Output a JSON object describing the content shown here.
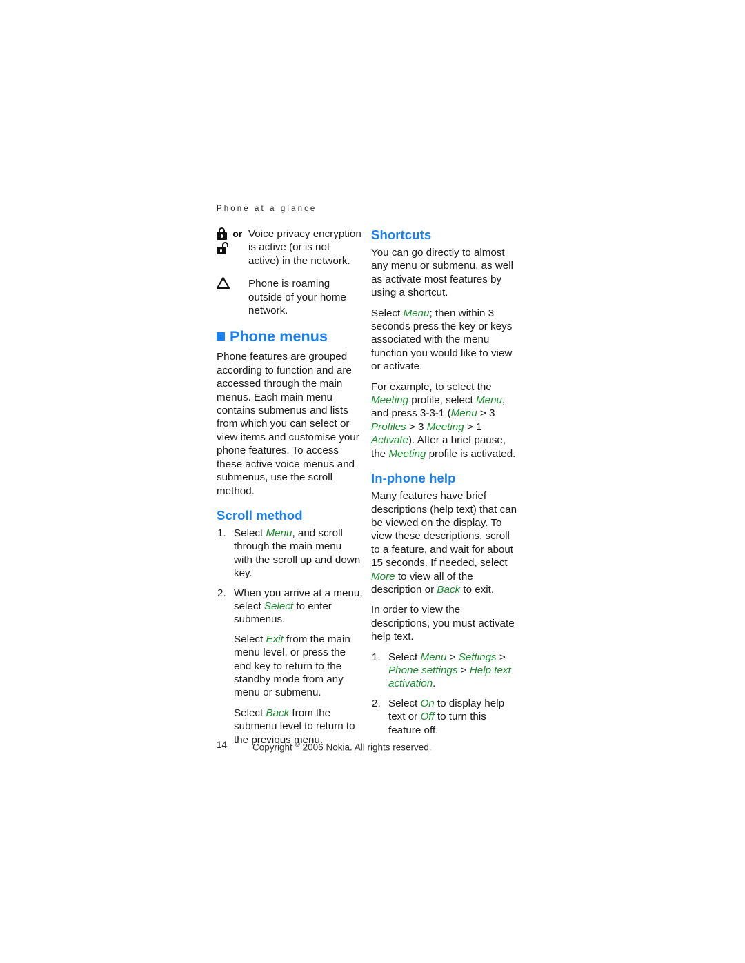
{
  "header": {
    "running_title": "Phone at a glance"
  },
  "icons": {
    "lock_closed": "padlock-closed-icon",
    "lock_open": "padlock-open-icon",
    "roaming": "roaming-triangle-icon",
    "or_label": "or"
  },
  "status_indicators": [
    {
      "text": "Voice privacy encryption is active (or is not active) in the network."
    },
    {
      "text": "Phone is roaming outside of your home network."
    }
  ],
  "left_column": {
    "chapter_heading": "Phone menus",
    "intro": "Phone features are grouped according to function and are accessed through the main menus. Each main menu contains submenus and lists from which you can select or view items and customise your phone features. To access these active voice menus and submenus, use the scroll method.",
    "scroll_method": {
      "heading": "Scroll method",
      "step1_pre": "Select ",
      "step1_term": "Menu",
      "step1_post": ", and scroll through the main menu with the scroll up and down key.",
      "step2_pre": "When you arrive at a menu, select ",
      "step2_term": "Select",
      "step2_post": " to enter submenus.",
      "note1_pre": "Select ",
      "note1_term": "Exit",
      "note1_post": " from the main menu level, or press the end key to return to the standby mode from any menu or submenu.",
      "note2_pre": "Select ",
      "note2_term": "Back",
      "note2_post": " from the submenu level to return to the previous menu."
    }
  },
  "right_column": {
    "shortcuts": {
      "heading": "Shortcuts",
      "p1": "You can go directly to almost any menu or submenu, as well as activate most features by using a shortcut.",
      "p2_pre": "Select ",
      "p2_term": "Menu",
      "p2_post": "; then within 3 seconds press the key or keys associated with the menu function you would like to view or activate.",
      "p3_a": "For example, to select the ",
      "p3_term1": "Meeting",
      "p3_b": " profile, select ",
      "p3_term2": "Menu",
      "p3_c": ", and press 3-3-1 (",
      "p3_term3": "Menu",
      "p3_d": " > 3 ",
      "p3_term4": "Profiles",
      "p3_e": " > 3 ",
      "p3_term5": "Meeting",
      "p3_f": " > 1 ",
      "p3_term6": "Activate",
      "p3_g": "). After a brief pause, the ",
      "p3_term7": "Meeting",
      "p3_h": " profile is activated."
    },
    "in_phone_help": {
      "heading": "In-phone help",
      "p1_a": "Many features have brief descriptions (help text) that can be viewed on the display. To view these descriptions, scroll to a feature, and wait for about 15 seconds. If needed, select ",
      "p1_term1": "More",
      "p1_b": " to view all of the description or ",
      "p1_term2": "Back",
      "p1_c": " to exit.",
      "p2": "In order to view the descriptions, you must activate help text.",
      "step1_pre": "Select ",
      "step1_term1": "Menu",
      "step1_sep1": " > ",
      "step1_term2": "Settings",
      "step1_sep2": " > ",
      "step1_term3": "Phone settings",
      "step1_sep3": " > ",
      "step1_term4": "Help text activation",
      "step1_post": ".",
      "step2_pre": "Select ",
      "step2_term1": "On",
      "step2_mid": " to display help text or ",
      "step2_term2": "Off",
      "step2_post": " to turn this feature off."
    }
  },
  "footer": {
    "page_number": "14",
    "copyright_pre": "Copyright ",
    "copyright_symbol": "©",
    "copyright_post": " 2006 Nokia. All rights reserved."
  },
  "colors": {
    "heading_blue": "#1a7ff0",
    "term_green": "#1a8a2e",
    "body_text": "#1a1a1a"
  }
}
